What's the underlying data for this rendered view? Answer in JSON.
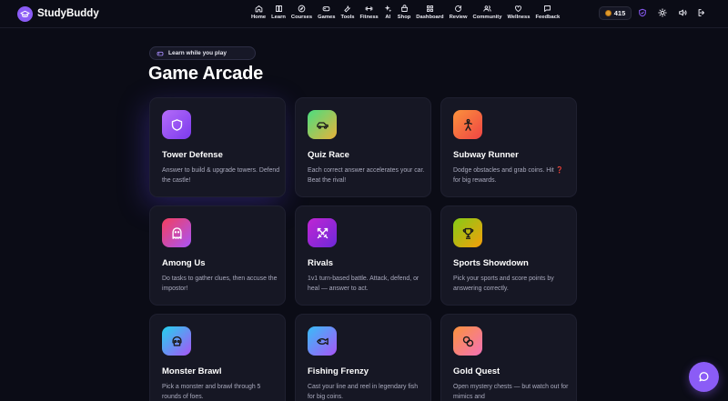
{
  "brand": {
    "name": "StudyBuddy"
  },
  "nav": [
    {
      "label": "Home",
      "icon": "home-icon"
    },
    {
      "label": "Learn",
      "icon": "book-icon"
    },
    {
      "label": "Courses",
      "icon": "compass-icon"
    },
    {
      "label": "Games",
      "icon": "gamepad-icon"
    },
    {
      "label": "Tools",
      "icon": "wrench-icon"
    },
    {
      "label": "Fitness",
      "icon": "dumbbell-icon"
    },
    {
      "label": "AI",
      "icon": "sparkle-icon"
    },
    {
      "label": "Shop",
      "icon": "shop-icon"
    },
    {
      "label": "Dashboard",
      "icon": "grid-icon"
    },
    {
      "label": "Review",
      "icon": "refresh-icon"
    },
    {
      "label": "Community",
      "icon": "users-icon"
    },
    {
      "label": "Wellness",
      "icon": "heart-icon"
    },
    {
      "label": "Feedback",
      "icon": "message-icon"
    }
  ],
  "coins": {
    "value": "415"
  },
  "header_icons": [
    "shield-check-icon",
    "sun-icon",
    "volume-icon",
    "logout-icon"
  ],
  "badge": {
    "text": "Learn while you play",
    "icon": "gamepad-icon"
  },
  "page": {
    "title": "Game Arcade"
  },
  "games": [
    {
      "title": "Tower Defense",
      "desc": "Answer to build & upgrade towers. Defend the castle!",
      "icon": "shield-icon",
      "gradient": [
        "#a855f7",
        "#7c3aed"
      ]
    },
    {
      "title": "Quiz Race",
      "desc": "Each correct answer accelerates your car. Beat the rival!",
      "icon": "car-icon",
      "gradient": [
        "#4ade80",
        "#f59e0b"
      ]
    },
    {
      "title": "Subway Runner",
      "desc": "Dodge obstacles and grab coins. Hit ❓ for big rewards.",
      "icon": "runner-icon",
      "gradient": [
        "#fb923c",
        "#ef4444"
      ]
    },
    {
      "title": "Among Us",
      "desc": "Do tasks to gather clues, then accuse the impostor!",
      "icon": "ghost-icon",
      "gradient": [
        "#f43f5e",
        "#a855f7"
      ]
    },
    {
      "title": "Rivals",
      "desc": "1v1 turn-based battle. Attack, defend, or heal — answer to act.",
      "icon": "swords-icon",
      "gradient": [
        "#c026d3",
        "#6d28d9"
      ]
    },
    {
      "title": "Sports Showdown",
      "desc": "Pick your sports and score points by answering correctly.",
      "icon": "trophy-icon",
      "gradient": [
        "#84cc16",
        "#f59e0b"
      ]
    },
    {
      "title": "Monster Brawl",
      "desc": "Pick a monster and brawl through 5 rounds of foes.",
      "icon": "skull-icon",
      "gradient": [
        "#22d3ee",
        "#a855f7"
      ]
    },
    {
      "title": "Fishing Frenzy",
      "desc": "Cast your line and reel in legendary fish for big coins.",
      "icon": "fish-icon",
      "gradient": [
        "#3b82f6",
        "#a855f7"
      ]
    },
    {
      "title": "Gold Quest",
      "desc": "Open mystery chests — but watch out for mimics and",
      "icon": "coins-icon",
      "gradient": [
        "#fb923c",
        "#f472b6"
      ]
    }
  ],
  "chat_button": {
    "icon": "chat-icon"
  }
}
